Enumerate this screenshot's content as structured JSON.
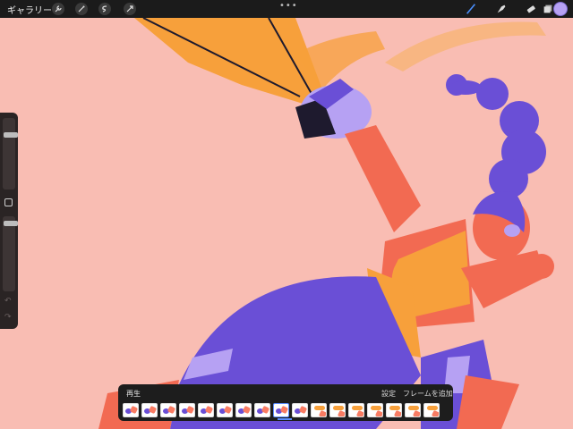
{
  "topbar": {
    "gallery_label": "ギャラリー",
    "tools_left": [
      "wrench-icon",
      "magic-wand-icon",
      "selection-icon",
      "transform-arrow-icon"
    ],
    "more_dots": "•••",
    "tools_right": [
      "brush-icon",
      "smudge-icon",
      "eraser-icon",
      "layers-icon"
    ],
    "color": "#b6a1f3"
  },
  "sidebar": {
    "brush_size_level": 0.21,
    "opacity_level": 0.06,
    "undo_icon": "undo-icon",
    "redo_icon": "redo-icon"
  },
  "timeline": {
    "play_label": "再生",
    "settings_label": "設定",
    "add_frame_label": "フレームを追加",
    "frame_count": 17,
    "selected_frame": 8
  },
  "colors": {
    "background": "#f9bdb3",
    "purple": "#6a4fd6",
    "orange": "#f7a03b",
    "coral": "#f26a52",
    "lavender": "#b6a1f3"
  }
}
